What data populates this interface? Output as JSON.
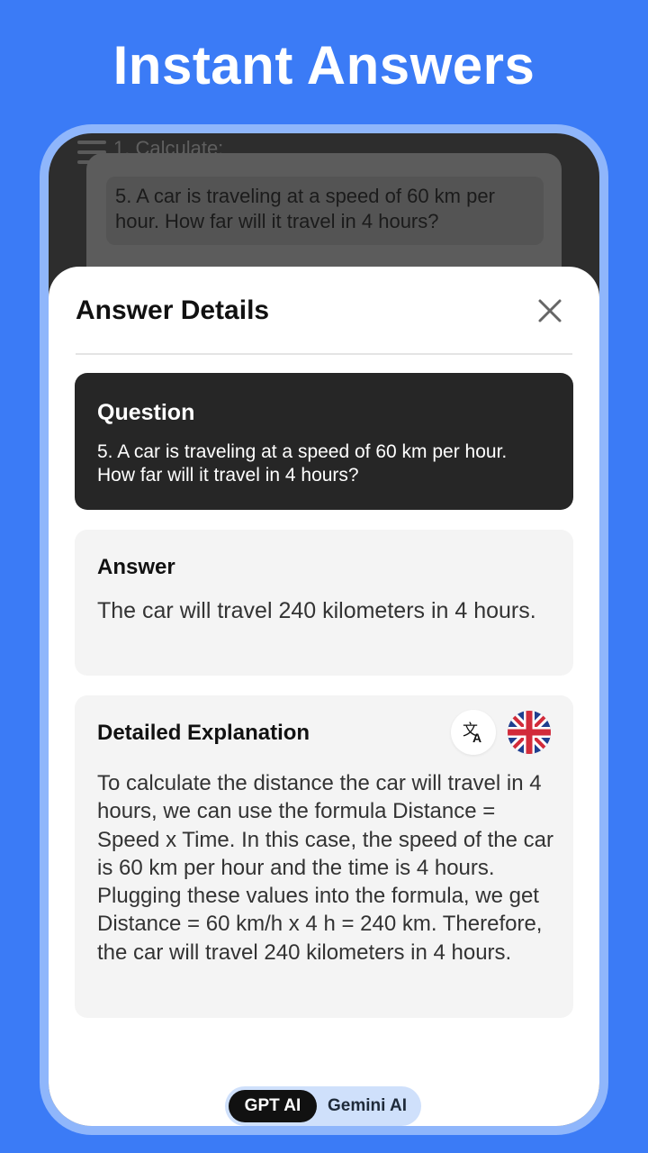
{
  "promo": {
    "title": "Instant Answers"
  },
  "background_app": {
    "heading": "1. Calculate:",
    "card_text": "5. A car is traveling at a speed of 60 km per hour. How far will it travel in 4 hours?"
  },
  "sheet": {
    "title": "Answer Details",
    "close_icon": "close-icon",
    "question": {
      "label": "Question",
      "text": "5. A car is traveling at a speed of 60 km per hour. How far will it travel in 4 hours?"
    },
    "answer": {
      "label": "Answer",
      "text": "The car will travel 240 kilometers in 4 hours."
    },
    "explanation": {
      "label": "Detailed Explanation",
      "text": "To calculate the distance the car will travel in 4 hours, we can use the formula Distance = Speed x Time. In this case, the speed of the car is 60 km per hour and the time is 4 hours. Plugging these values into the formula, we get Distance = 60 km/h x 4 h = 240 km. Therefore, the car will travel 240 kilometers in 4 hours.",
      "translate_icon": "translate-icon",
      "language_flag_icon": "uk-flag-icon"
    }
  },
  "model_toggle": {
    "options": [
      "GPT AI",
      "Gemini AI"
    ],
    "selected": "GPT AI"
  },
  "colors": {
    "background": "#3b7bf6",
    "frame": "#8fb6fb",
    "question_card": "#262626",
    "content_card": "#f4f4f4",
    "toggle_bg": "#cfe0fb",
    "toggle_active": "#111111"
  }
}
